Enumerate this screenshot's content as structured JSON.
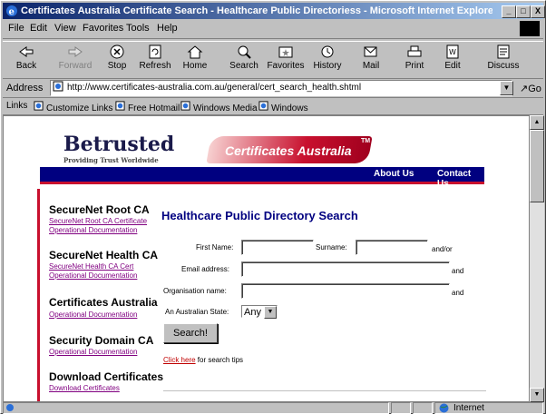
{
  "window": {
    "title": "Certificates Australia Certificate Search - Healthcare Public Directoriess - Microsoft Internet Explorer provi...",
    "controls": [
      "_",
      "□",
      "X"
    ]
  },
  "menu": [
    "File",
    "Edit",
    "View",
    "Favorites",
    "Tools",
    "Help"
  ],
  "toolbar": [
    {
      "label": "Back",
      "icon": "back-arrow-icon"
    },
    {
      "label": "Forward",
      "icon": "forward-arrow-icon",
      "disabled": true
    },
    {
      "label": "Stop",
      "icon": "stop-icon"
    },
    {
      "label": "Refresh",
      "icon": "refresh-icon"
    },
    {
      "label": "Home",
      "icon": "home-icon"
    },
    {
      "label": "Search",
      "icon": "search-icon"
    },
    {
      "label": "Favorites",
      "icon": "favorites-icon"
    },
    {
      "label": "History",
      "icon": "history-icon"
    },
    {
      "label": "Mail",
      "icon": "mail-icon"
    },
    {
      "label": "Print",
      "icon": "print-icon"
    },
    {
      "label": "Edit",
      "icon": "edit-icon"
    },
    {
      "label": "Discuss",
      "icon": "discuss-icon"
    }
  ],
  "address": {
    "label": "Address",
    "url": "http://www.certificates-australia.com.au/general/cert_search_health.shtml",
    "go": "Go"
  },
  "links": {
    "label": "Links",
    "items": [
      "Customize Links",
      "Free Hotmail",
      "Windows Media",
      "Windows"
    ]
  },
  "banner": {
    "brand": "Betrusted",
    "tagline": "Providing Trust Worldwide",
    "partner": "Certificates Australia",
    "tm": "TM",
    "nav": [
      "About Us",
      "Contact Us"
    ]
  },
  "sidebar": [
    {
      "title": "SecureNet Root CA",
      "links": [
        "SecureNet Root CA Certificate",
        "Operational Documentation"
      ]
    },
    {
      "title": "SecureNet Health CA",
      "links": [
        "SecureNet Health CA Cert",
        "Operational Documentation"
      ]
    },
    {
      "title": "Certificates Australia",
      "links": [
        "Operational Documentation"
      ]
    },
    {
      "title": "Security Domain CA",
      "links": [
        "Operational Documentation"
      ]
    },
    {
      "title": "Download Certificates",
      "links": [
        "Download Certificates"
      ]
    }
  ],
  "form": {
    "heading": "Healthcare Public Directory Search",
    "first_name_label": "First Name:",
    "surname_label": "Surname:",
    "andor": "and/or",
    "email_label": "Email address:",
    "org_label": "Organisation name:",
    "and": "and",
    "state_label": "An Australian State:",
    "state_value": "Any",
    "search_button": "Search!",
    "tips_link": "Click here",
    "tips_text": " for search tips"
  },
  "status": {
    "zone": "Internet"
  },
  "colors": {
    "title_gradient_start": "#0a246a",
    "nav_blue": "#000080",
    "brand_red": "#c8102e",
    "link_purple": "#800080"
  }
}
